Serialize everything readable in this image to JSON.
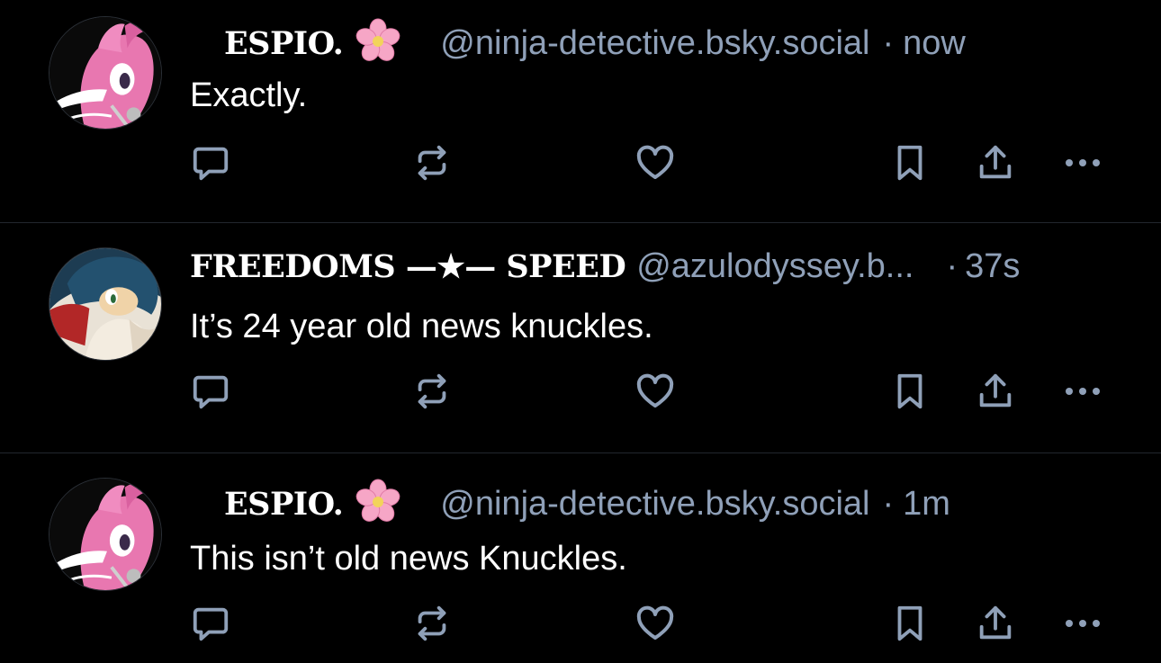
{
  "colors": {
    "background": "#000000",
    "text": "#ffffff",
    "secondary": "#8fa0b8",
    "icon": "#8fa0b8",
    "divider": "#22272e"
  },
  "posts": [
    {
      "display_name": "ESPIO.",
      "emoji": "cherry-blossom",
      "handle": "@ninja-detective.bsky.social",
      "separator": "·",
      "time": "now",
      "text": "Exactly.",
      "avatar": "pink-chameleon-avatar"
    },
    {
      "display_name": "FREEDOMS —★— SPEED",
      "handle": "@azulodyssey.b...",
      "separator": "·",
      "time": "37s",
      "text": "It’s 24 year old news knuckles.",
      "avatar": "blue-hedgehog-avatar"
    },
    {
      "display_name": "ESPIO.",
      "emoji": "cherry-blossom",
      "handle": "@ninja-detective.bsky.social",
      "separator": "·",
      "time": "1m",
      "text": "This isn’t old news Knuckles.",
      "avatar": "pink-chameleon-avatar"
    }
  ],
  "actions": [
    "reply-icon",
    "repost-icon",
    "like-icon",
    "bookmark-icon",
    "share-icon",
    "more-icon"
  ]
}
